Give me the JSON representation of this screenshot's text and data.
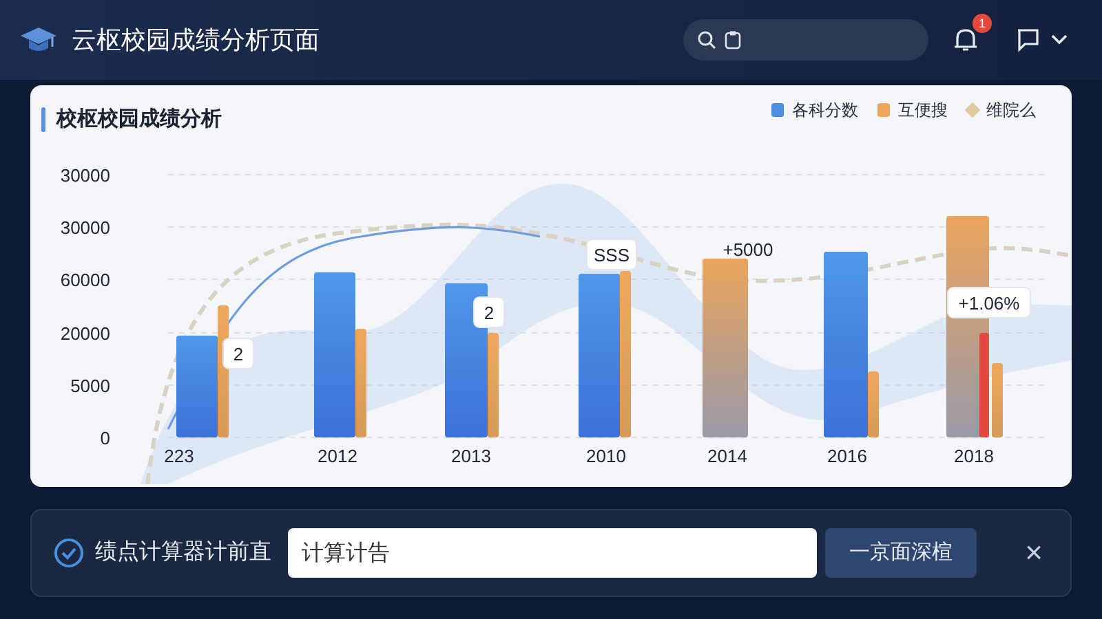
{
  "header": {
    "title": "云枢校园成绩分析页面",
    "notification_badge": "1"
  },
  "chart_card": {
    "title": "校枢校园成绩分析",
    "legend": [
      {
        "label": "各科分数",
        "color": "#4a8fe0",
        "kind": "square"
      },
      {
        "label": "互便搜",
        "color": "#eea85c",
        "kind": "square"
      },
      {
        "label": "维院么",
        "color": "#e2caa2",
        "kind": "diamond"
      }
    ],
    "y_axis_labels": [
      "30000",
      "30000",
      "60000",
      "20000",
      "5000",
      "0"
    ],
    "x_axis_labels": [
      "223",
      "2012",
      "2013",
      "2010",
      "2014",
      "2016",
      "2018"
    ],
    "callouts": [
      {
        "text": "2",
        "kind": "boxed"
      },
      {
        "text": "2",
        "kind": "boxed"
      },
      {
        "text": "SSS",
        "kind": "boxed"
      },
      {
        "text": "+5000",
        "kind": "plain"
      },
      {
        "text": "+1.06%",
        "kind": "boxed"
      }
    ]
  },
  "calculator_bar": {
    "checked": true,
    "label": "绩点计算器计前直",
    "input_value": "计算计告",
    "button": "一京面深楦",
    "close": "×"
  }
}
